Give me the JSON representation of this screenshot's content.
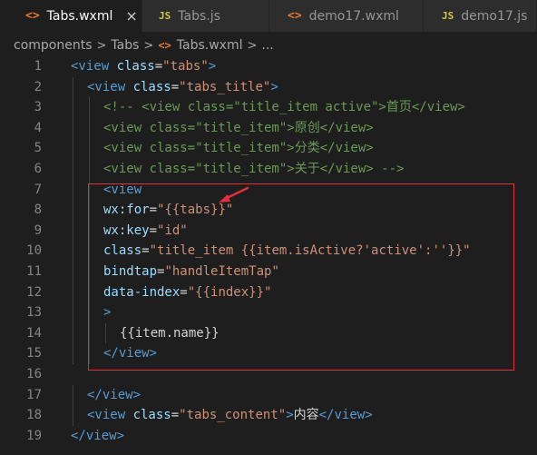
{
  "tabs": [
    {
      "icon": "<>",
      "label": "Tabs.wxml",
      "close": "×",
      "active": true
    },
    {
      "icon": "JS",
      "label": "Tabs.js",
      "active": false
    },
    {
      "icon": "<>",
      "label": "demo17.wxml",
      "active": false
    },
    {
      "icon": "JS",
      "label": "demo17.js",
      "active": false
    }
  ],
  "breadcrumb": {
    "items": [
      "components",
      "Tabs",
      "Tabs.wxml",
      "..."
    ],
    "separator": ">",
    "file_icon": "<>"
  },
  "lines": [
    {
      "n": "1",
      "indent": 0,
      "tokens": [
        [
          "tag",
          "<view "
        ],
        [
          "attr",
          "class"
        ],
        [
          "txt",
          "="
        ],
        [
          "str",
          "\"tabs\""
        ],
        [
          "tag",
          ">"
        ]
      ]
    },
    {
      "n": "2",
      "indent": 1,
      "tokens": [
        [
          "tag",
          "<view "
        ],
        [
          "attr",
          "class"
        ],
        [
          "txt",
          "="
        ],
        [
          "str",
          "\"tabs_title\""
        ],
        [
          "tag",
          ">"
        ]
      ]
    },
    {
      "n": "3",
      "indent": 2,
      "tokens": [
        [
          "cmt",
          "<!-- <view class=\"title_item active\">首页</view>"
        ]
      ]
    },
    {
      "n": "4",
      "indent": 2,
      "tokens": [
        [
          "cmt",
          "<view class=\"title_item\">原创</view>"
        ]
      ]
    },
    {
      "n": "5",
      "indent": 2,
      "tokens": [
        [
          "cmt",
          "<view class=\"title_item\">分类</view>"
        ]
      ]
    },
    {
      "n": "6",
      "indent": 2,
      "tokens": [
        [
          "cmt",
          "<view class=\"title_item\">关于</view> -->"
        ]
      ]
    },
    {
      "n": "7",
      "indent": 2,
      "tokens": [
        [
          "tag",
          "<view"
        ]
      ]
    },
    {
      "n": "8",
      "indent": 2,
      "tokens": [
        [
          "attr",
          "wx:for"
        ],
        [
          "txt",
          "="
        ],
        [
          "str",
          "\"{{tabs}}\""
        ]
      ]
    },
    {
      "n": "9",
      "indent": 2,
      "tokens": [
        [
          "attr",
          "wx:key"
        ],
        [
          "txt",
          "="
        ],
        [
          "str",
          "\"id\""
        ]
      ]
    },
    {
      "n": "10",
      "indent": 2,
      "tokens": [
        [
          "attr",
          "class"
        ],
        [
          "txt",
          "="
        ],
        [
          "str",
          "\"title_item {{item.isActive?'active':''}}\""
        ]
      ]
    },
    {
      "n": "11",
      "indent": 2,
      "tokens": [
        [
          "attr",
          "bindtap"
        ],
        [
          "txt",
          "="
        ],
        [
          "str",
          "\"handleItemTap\""
        ]
      ]
    },
    {
      "n": "12",
      "indent": 2,
      "tokens": [
        [
          "attr",
          "data-index"
        ],
        [
          "txt",
          "="
        ],
        [
          "str",
          "\"{{index}}\""
        ]
      ]
    },
    {
      "n": "13",
      "indent": 2,
      "tokens": [
        [
          "tag",
          ">"
        ]
      ]
    },
    {
      "n": "14",
      "indent": 3,
      "tokens": [
        [
          "txt",
          "{{item.name}}"
        ]
      ]
    },
    {
      "n": "15",
      "indent": 2,
      "tokens": [
        [
          "tag",
          "</view>"
        ]
      ]
    },
    {
      "n": "16",
      "indent": 0,
      "tokens": []
    },
    {
      "n": "17",
      "indent": 1,
      "tokens": [
        [
          "tag",
          "</view>"
        ]
      ]
    },
    {
      "n": "18",
      "indent": 1,
      "tokens": [
        [
          "tag",
          "<view "
        ],
        [
          "attr",
          "class"
        ],
        [
          "txt",
          "="
        ],
        [
          "str",
          "\"tabs_content\""
        ],
        [
          "tag",
          ">"
        ],
        [
          "txt",
          "内容"
        ],
        [
          "tag",
          "</view>"
        ]
      ]
    },
    {
      "n": "19",
      "indent": 0,
      "tokens": [
        [
          "tag",
          "</view>"
        ]
      ]
    }
  ],
  "colors": {
    "tag": "#569cd6",
    "attr": "#9cdcfe",
    "string": "#ce9178",
    "comment": "#6a9955",
    "highlight_box": "#e0303a",
    "arrow": "#e0303a"
  }
}
